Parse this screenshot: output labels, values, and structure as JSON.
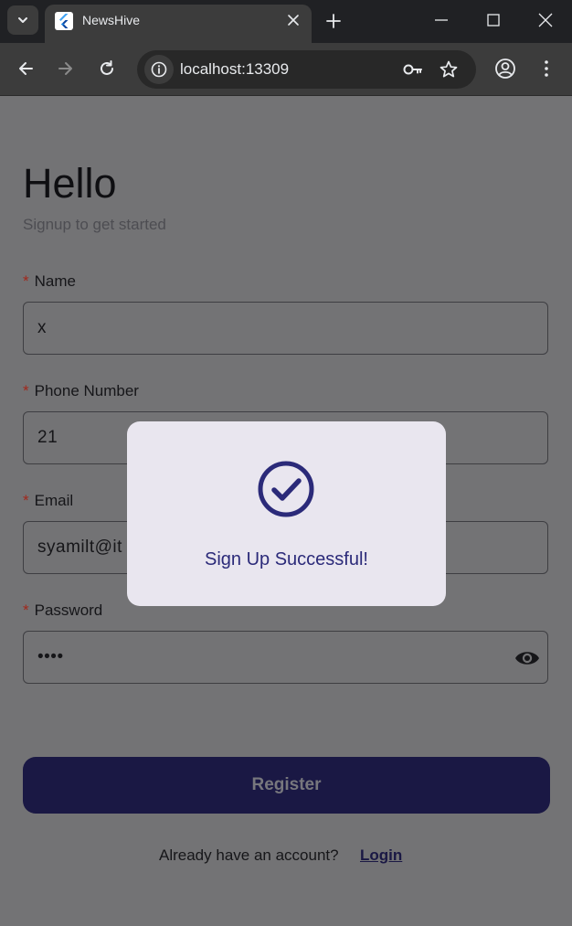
{
  "browser": {
    "tab_title": "NewsHive",
    "url": "localhost:13309"
  },
  "page": {
    "heading": "Hello",
    "subtitle": "Signup to get started",
    "required_marker": "*",
    "fields": [
      {
        "label": "Name",
        "value": "x"
      },
      {
        "label": "Phone Number",
        "value": "21"
      },
      {
        "label": "Email",
        "value": "syamilt@it"
      },
      {
        "label": "Password",
        "value": "••••"
      }
    ],
    "register_label": "Register",
    "footer_text": "Already have an account?",
    "login_label": "Login"
  },
  "dialog": {
    "message": "Sign Up Successful!",
    "icon": "check-circle-icon"
  },
  "colors": {
    "overlay_page": "#737375",
    "button": "#1a1844",
    "dialog_bg": "#e9e6ef",
    "dialog_accent": "#2b2a79",
    "required": "#a1281c"
  }
}
